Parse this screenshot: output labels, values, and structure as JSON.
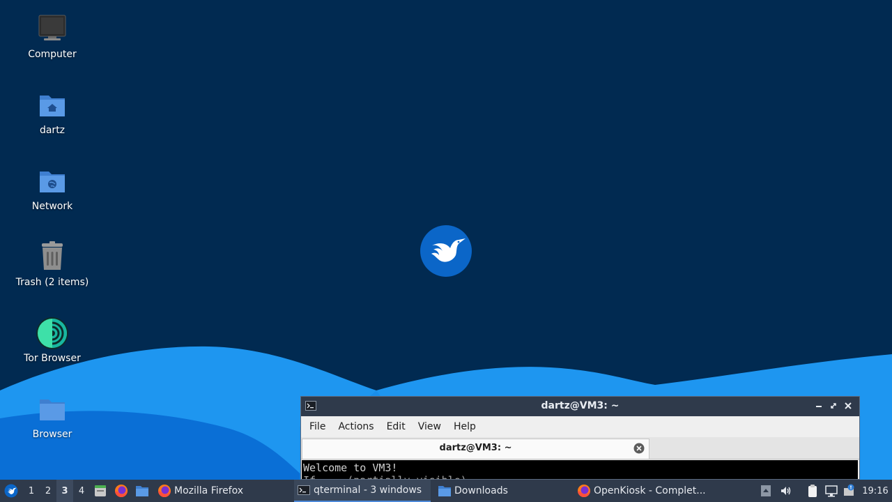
{
  "desktop": {
    "icons": [
      {
        "label": "Computer",
        "icon": "computer-icon"
      },
      {
        "label": "dartz",
        "icon": "home-folder-icon"
      },
      {
        "label": "Network",
        "icon": "network-folder-icon"
      },
      {
        "label": "Trash (2 items)",
        "icon": "trash-icon"
      },
      {
        "label": "Tor Browser",
        "icon": "tor-browser-icon"
      },
      {
        "label": "Browser",
        "icon": "folder-icon"
      }
    ],
    "wallpaper_colors": {
      "sky": "#012a51",
      "wave_light": "#1e96f0",
      "wave_dark": "#0a6fd6"
    }
  },
  "terminal": {
    "title": "dartz@VM3: ~",
    "menu": [
      "File",
      "Actions",
      "Edit",
      "View",
      "Help"
    ],
    "tab_label": "dartz@VM3: ~",
    "lines": [
      "Welcome to VM3!",
      "If ... (partially visible)"
    ]
  },
  "taskbar": {
    "workspaces": [
      "1",
      "2",
      "3",
      "4"
    ],
    "active_workspace": "3",
    "tasks": [
      {
        "label": "Mozilla Firefox",
        "icon": "firefox-icon"
      },
      {
        "label": "qterminal - 3 windows",
        "icon": "terminal-icon"
      },
      {
        "label": "Downloads",
        "icon": "folder-icon"
      },
      {
        "label": "OpenKiosk - Complet...",
        "icon": "firefox-icon"
      }
    ],
    "clock": "19:16",
    "accent": "#4e8ad9"
  }
}
